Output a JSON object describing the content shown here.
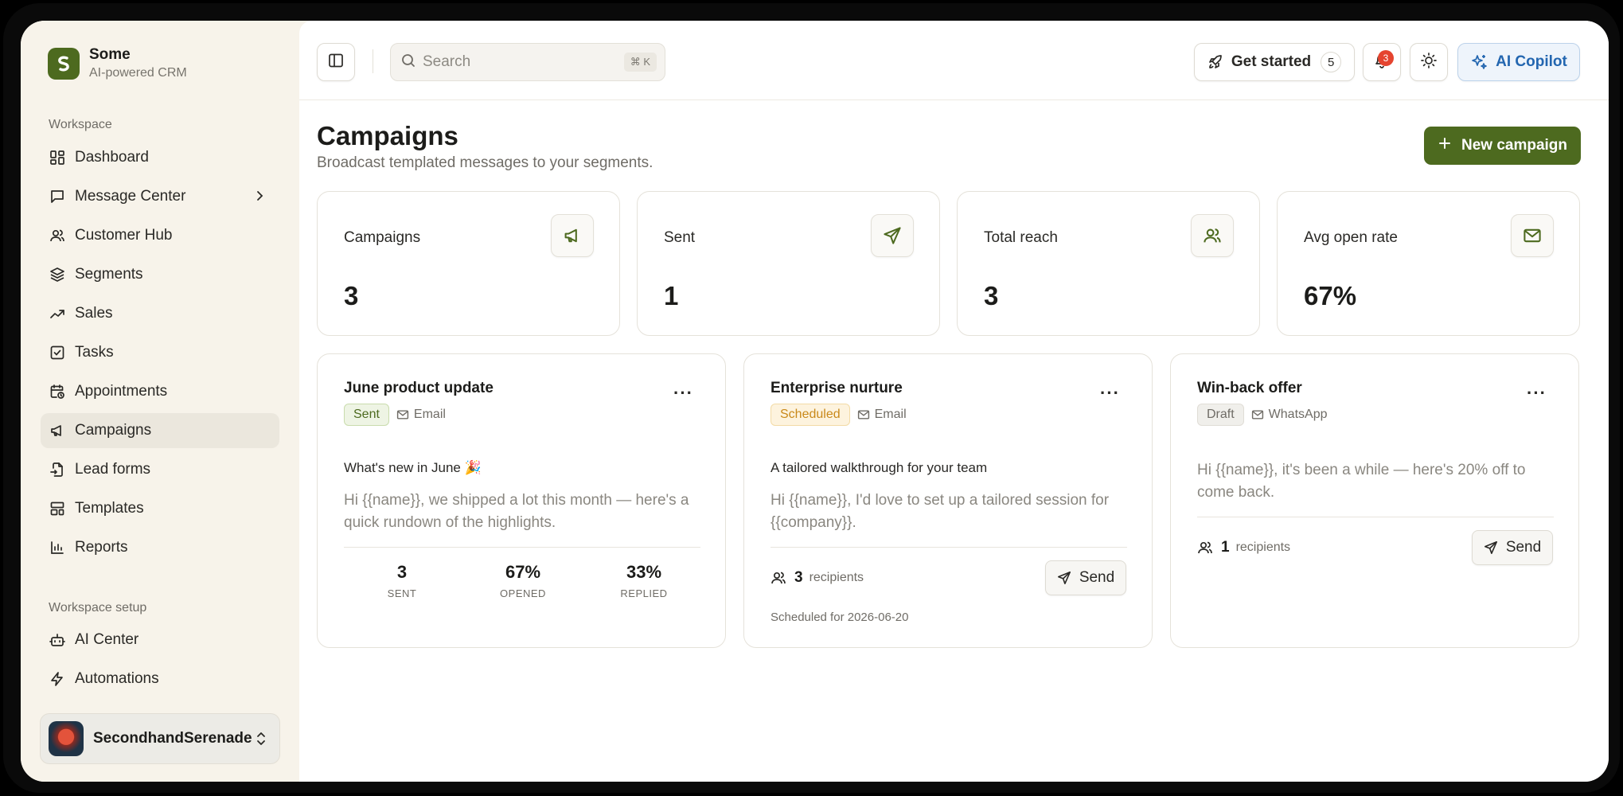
{
  "brand": {
    "name": "Some",
    "tagline": "AI-powered CRM"
  },
  "sidebar": {
    "workspace_label": "Workspace",
    "items": [
      {
        "label": "Dashboard",
        "icon": "layout-grid-icon"
      },
      {
        "label": "Message Center",
        "icon": "message-square-icon",
        "has_children": true
      },
      {
        "label": "Customer Hub",
        "icon": "users-icon"
      },
      {
        "label": "Segments",
        "icon": "layers-icon"
      },
      {
        "label": "Sales",
        "icon": "trending-up-icon"
      },
      {
        "label": "Tasks",
        "icon": "check-square-icon"
      },
      {
        "label": "Appointments",
        "icon": "calendar-clock-icon"
      },
      {
        "label": "Campaigns",
        "icon": "megaphone-icon",
        "active": true
      },
      {
        "label": "Lead forms",
        "icon": "file-input-icon"
      },
      {
        "label": "Templates",
        "icon": "layout-template-icon"
      },
      {
        "label": "Reports",
        "icon": "bar-chart-icon"
      }
    ],
    "setup_label": "Workspace setup",
    "setup_items": [
      {
        "label": "AI Center",
        "icon": "bot-icon"
      },
      {
        "label": "Automations",
        "icon": "zap-icon"
      }
    ],
    "account": {
      "name": "SecondhandSerenade"
    }
  },
  "topbar": {
    "search_placeholder": "Search",
    "search_shortcut": "⌘ K",
    "get_started_label": "Get started",
    "get_started_count": "5",
    "notification_count": "3",
    "copilot_label": "AI Copilot"
  },
  "page": {
    "title": "Campaigns",
    "subtitle": "Broadcast templated messages to your segments.",
    "new_button": "New campaign"
  },
  "stats": [
    {
      "label": "Campaigns",
      "value": "3",
      "icon": "megaphone-icon"
    },
    {
      "label": "Sent",
      "value": "1",
      "icon": "send-icon"
    },
    {
      "label": "Total reach",
      "value": "3",
      "icon": "users-icon"
    },
    {
      "label": "Avg open rate",
      "value": "67%",
      "icon": "mail-icon"
    }
  ],
  "campaigns": [
    {
      "title": "June product update",
      "status": "Sent",
      "channel": "Email",
      "subject": "What's new in June 🎉",
      "body": "Hi {{name}}, we shipped a lot this month — here's a quick rundown of the highlights.",
      "metrics": [
        {
          "value": "3",
          "label": "SENT"
        },
        {
          "value": "67%",
          "label": "OPENED"
        },
        {
          "value": "33%",
          "label": "REPLIED"
        }
      ]
    },
    {
      "title": "Enterprise nurture",
      "status": "Scheduled",
      "channel": "Email",
      "subject": "A tailored walkthrough for your team",
      "body": "Hi {{name}}, I'd love to set up a tailored session for {{company}}.",
      "recipients": "3",
      "recipients_label": "recipients",
      "send_label": "Send",
      "scheduled_text": "Scheduled for 2026-06-20"
    },
    {
      "title": "Win-back offer",
      "status": "Draft",
      "channel": "WhatsApp",
      "body": "Hi {{name}}, it's been a while — here's 20% off to come back.",
      "recipients": "1",
      "recipients_label": "recipients",
      "send_label": "Send"
    }
  ],
  "colors": {
    "brand_green": "#4d6a1f",
    "copilot_blue": "#2366b0",
    "badge_red": "#e5442f",
    "scheduled_amber": "#c9891a"
  }
}
